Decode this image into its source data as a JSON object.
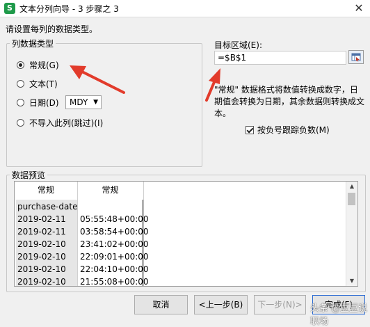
{
  "window": {
    "app_icon": "S",
    "title": "文本分列向导 - 3 步骤之 3",
    "close_glyph": "✕"
  },
  "instruction": "请设置每列的数据类型。",
  "column_type": {
    "legend": "列数据类型",
    "options": [
      {
        "label": "常规(G)",
        "selected": true
      },
      {
        "label": "文本(T)",
        "selected": false
      },
      {
        "label": "日期(D)",
        "selected": false
      },
      {
        "label": "不导入此列(跳过)(I)",
        "selected": false
      }
    ],
    "date_format": "MDY"
  },
  "destination": {
    "label": "目标区域(E):",
    "value": "=$B$1",
    "picker_icon": "range-picker-icon"
  },
  "description": "\"常规\" 数据格式将数值转换成数字，日期值会转换为日期，其余数据则转换成文本。",
  "negative_checkbox": {
    "label": "按负号跟踪负数(M)",
    "checked": true
  },
  "preview": {
    "legend": "数据预览",
    "headers": [
      "常规",
      "常规"
    ],
    "rows": [
      [
        "purchase-date",
        ""
      ],
      [
        "2019-02-11",
        "05:55:48+00:00"
      ],
      [
        "2019-02-11",
        "03:58:54+00:00"
      ],
      [
        "2019-02-10",
        "23:41:02+00:00"
      ],
      [
        "2019-02-10",
        "22:09:01+00:00"
      ],
      [
        "2019-02-10",
        "22:04:10+00:00"
      ],
      [
        "2019-02-10",
        "21:55:08+00:00"
      ]
    ]
  },
  "buttons": {
    "cancel": "取消",
    "back": "<上一步(B)",
    "next": "下一步(N)>",
    "finish": "完成(F)"
  },
  "watermark": "头条 @豆豆说职场",
  "colors": {
    "arrow": "#e23b2b",
    "accent": "#2a6bd3",
    "app_icon": "#1f9a4a"
  }
}
